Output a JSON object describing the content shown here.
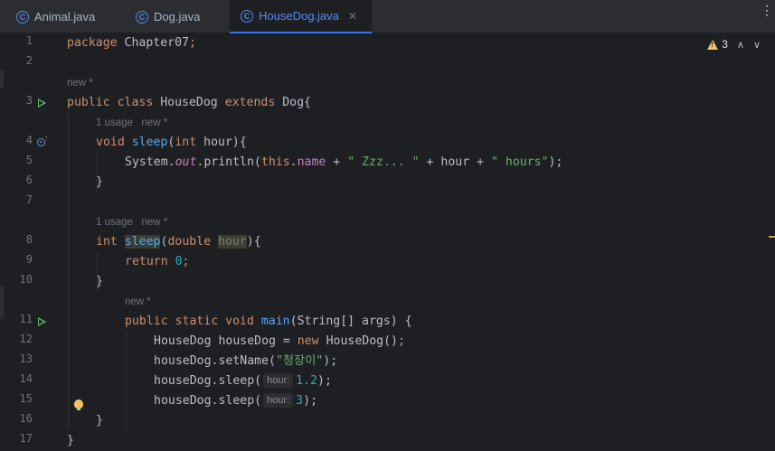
{
  "tabs": [
    {
      "label": "Animal.java",
      "icon": "java-class-icon",
      "active": false
    },
    {
      "label": "Dog.java",
      "icon": "java-class-icon",
      "active": false
    },
    {
      "label": "HouseDog.java",
      "icon": "java-class-icon",
      "active": true
    }
  ],
  "tab_icon_letter": "C",
  "close_glyph": "✕",
  "menu_glyph": "⋮",
  "inspections": {
    "warning_count": "3",
    "up": "∧",
    "down": "∨"
  },
  "line_numbers": [
    "1",
    "2",
    "3",
    "4",
    "5",
    "6",
    "7",
    "8",
    "9",
    "10",
    "11",
    "12",
    "13",
    "14",
    "15",
    "16",
    "17"
  ],
  "hints": {
    "class_new": "new *",
    "sleep1_usage": "1 usage   new *",
    "sleep2_usage": "1 usage   new *",
    "main_new": "new *"
  },
  "code": {
    "l1_kw": "package",
    "l1_rest": " Chapter07",
    "l1_semi": ";",
    "l3_kw": "public class",
    "l3_name": " HouseDog ",
    "l3_ext": "extends",
    "l3_rest": " Dog{",
    "l4_kw": "void",
    "l4_fn": " sleep",
    "l4_p1": "(",
    "l4_kw2": "int",
    "l4_rest": " hour){",
    "l5_a": "System.",
    "l5_out": "out",
    "l5_b": ".println(",
    "l5_this": "this",
    "l5_c": ".",
    "l5_name": "name",
    "l5_d": " + ",
    "l5_s1": "\" Zzz... \"",
    "l5_e": " + hour + ",
    "l5_s2": "\" hours\"",
    "l5_f": ");",
    "l6": "}",
    "l8_kw": "int",
    "l8_fn": "sleep",
    "l8_p1": "(",
    "l8_kw2": "double",
    "l8_sp": " ",
    "l8_par": "hour",
    "l8_rest": "){",
    "l9_kw": "return",
    "l9_num": " 0",
    "l9_semi": ";",
    "l10": "}",
    "l11_kw": "public static void",
    "l11_fn": " main",
    "l11_rest": "(String[] args) {",
    "l12_a": "HouseDog houseDog = ",
    "l12_kw": "new",
    "l12_b": " HouseDog()",
    "l12_semi": ";",
    "l13_a": "houseDog.setName(",
    "l13_str": "\"청장이\"",
    "l13_b": ");",
    "l14_a": "houseDog.sleep(",
    "l14_hint": "hour:",
    "l14_num": "1.2",
    "l14_b": ");",
    "l15_a": "houseDog.sleep(",
    "l15_hint": "hour:",
    "l15_num": "3",
    "l15_b": ");",
    "l16": "}",
    "l17": "}"
  },
  "colors": {
    "keyword": "#cf8e6d",
    "function": "#56a8f5",
    "string": "#6aab73",
    "number": "#2aacb8",
    "field": "#c77dbb",
    "active_tab": "#548af7",
    "run_icon": "#5fb865",
    "warning": "#f2c55c"
  }
}
